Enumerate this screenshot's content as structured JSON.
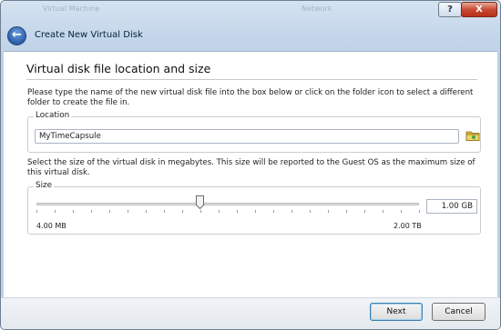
{
  "window": {
    "background_labels": [
      "Virtual Machine",
      "Network"
    ],
    "help_glyph": "?",
    "close_glyph": "X"
  },
  "wizard": {
    "title": "Create New Virtual Disk",
    "page_title": "Virtual disk file location and size",
    "location_description": "Please type the name of the new virtual disk file into the box below or click on the folder icon to select a different folder to create the file in.",
    "location_label": "Location",
    "location_value": "MyTimeCapsule",
    "size_description": "Select the size of the virtual disk in megabytes. This size will be reported to the Guest OS as the maximum size of this virtual disk.",
    "size_label": "Size",
    "size_value": "1.00 GB",
    "size_min_label": "4.00 MB",
    "size_max_label": "2.00 TB",
    "slider_position_fraction": 0.425
  },
  "buttons": {
    "next": "Next",
    "cancel": "Cancel"
  },
  "icons": {
    "back": "back-arrow-icon",
    "folder": "folder-icon"
  },
  "colors": {
    "accent": "#3c7fb1",
    "close": "#c74a34"
  }
}
